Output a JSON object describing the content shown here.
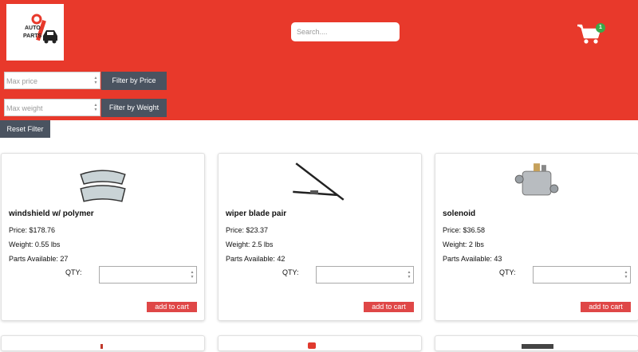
{
  "logo": {
    "line1": "AUTO",
    "line2": "PARTS"
  },
  "search": {
    "placeholder": "Search...."
  },
  "cart": {
    "count": "1"
  },
  "filters": {
    "max_price_placeholder": "Max price",
    "filter_price_label": "Filter by Price",
    "max_weight_placeholder": "Max weight",
    "filter_weight_label": "Filter by Weight",
    "reset_label": "Reset Filter"
  },
  "products": [
    {
      "name": "windshield w/ polymer",
      "price": "Price: $178.76",
      "weight": "Weight: 0.55 lbs",
      "available": "Parts Available: 27",
      "qty_label": "QTY:",
      "add_label": "add to cart",
      "icon": "windshield-icon"
    },
    {
      "name": "wiper blade pair",
      "price": "Price: $23.37",
      "weight": "Weight: 2.5 lbs",
      "available": "Parts Available: 42",
      "qty_label": "QTY:",
      "add_label": "add to cart",
      "icon": "wiper-blade-icon"
    },
    {
      "name": "solenoid",
      "price": "Price: $36.58",
      "weight": "Weight: 2 lbs",
      "available": "Parts Available: 43",
      "qty_label": "QTY:",
      "add_label": "add to cart",
      "icon": "solenoid-icon"
    }
  ],
  "colors": {
    "header": "#e8392b",
    "button_dark": "#4a5360",
    "add_to_cart": "#df4747",
    "badge": "#3aa94a"
  }
}
